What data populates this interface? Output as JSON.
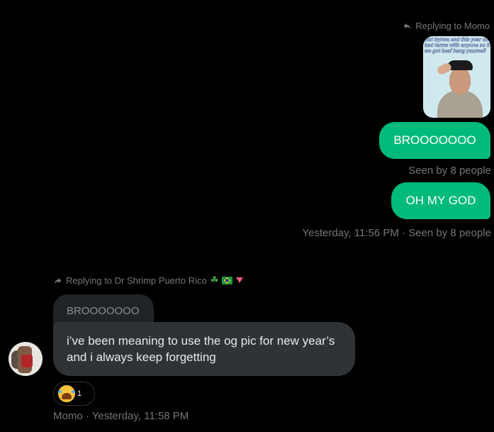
{
  "outgoing": {
    "reply_label": "Replying to Momo",
    "image_meme_text": "Not trynna end this year on bad terms with anyone so if we got beef hang yourself",
    "messages": [
      "BROOOOOOO",
      "OH MY GOD"
    ],
    "seen_1": "Seen by 8 people",
    "seen_2": "Yesterday, 11:56 PM · Seen by 8 people"
  },
  "incoming": {
    "reply_label": "Replying to Dr Shrimp Puerto Rico",
    "reply_emojis": [
      "shamrock",
      "brazil-flag",
      "pink-triangle"
    ],
    "quoted_text": "BROOOOOOO",
    "message": "i’ve been meaning to use the og pic for new year’s and i always keep forgetting",
    "reaction_emoji": "loudly-crying-face",
    "reaction_count": "1",
    "footer": "Momo · Yesterday, 11:58 PM"
  },
  "colors": {
    "background": "#000000",
    "outgoing_bubble": "#00ba7c",
    "incoming_bubble": "#2f3336",
    "muted_text": "#71767b"
  }
}
